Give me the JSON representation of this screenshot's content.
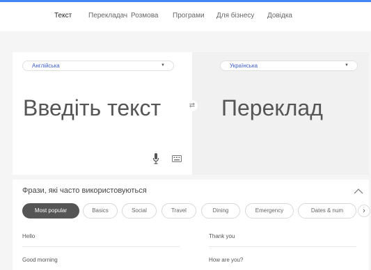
{
  "nav": {
    "items": [
      {
        "label": "Текст",
        "active": true
      },
      {
        "label": "Перекладач",
        "active": false
      },
      {
        "label": "Розмова",
        "active": false
      },
      {
        "label": "Програми",
        "active": false
      },
      {
        "label": "Для бізнесу",
        "active": false
      },
      {
        "label": "Довідка",
        "active": false
      }
    ]
  },
  "source": {
    "language": "Англійська",
    "placeholder": "Введіть текст",
    "icons": [
      "microphone-icon",
      "keyboard-icon"
    ]
  },
  "target": {
    "language": "Українська",
    "placeholder": "Переклад"
  },
  "swap_icon": "swap-icon",
  "phrases": {
    "title": "Фрази, які часто використовуються",
    "categories": [
      {
        "label": "Most popular",
        "active": true
      },
      {
        "label": "Basics",
        "active": false
      },
      {
        "label": "Social",
        "active": false
      },
      {
        "label": "Travel",
        "active": false
      },
      {
        "label": "Dining",
        "active": false
      },
      {
        "label": "Emergency",
        "active": false
      },
      {
        "label": "Dates & num",
        "active": false
      }
    ],
    "items": [
      "Hello",
      "Thank you",
      "Good morning",
      "How are you?"
    ]
  },
  "colors": {
    "accent": "#4285f4",
    "link": "#3a5dc7",
    "chip_active": "#555555"
  }
}
